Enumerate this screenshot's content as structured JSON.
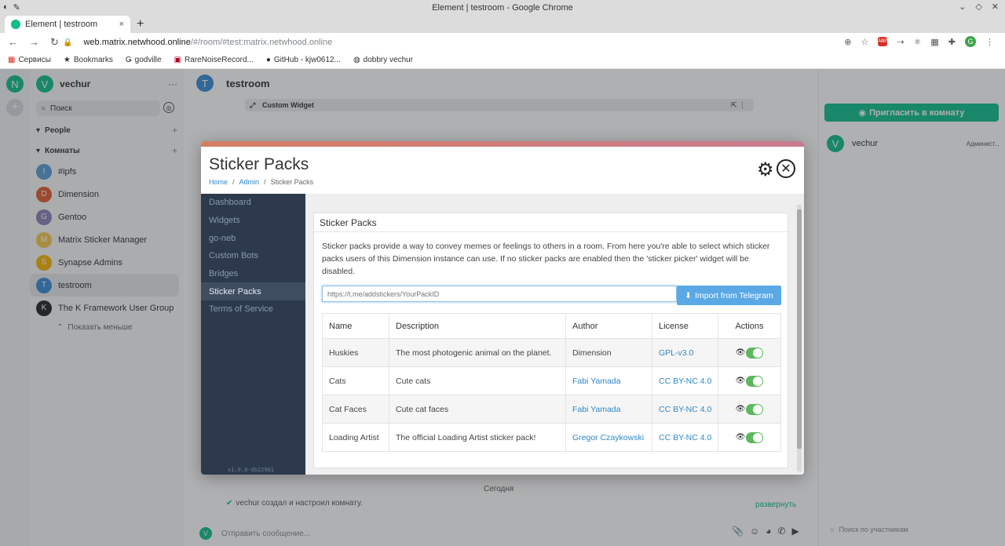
{
  "window": {
    "title": "Element | testroom - Google Chrome"
  },
  "tab": {
    "label": "Element | testroom",
    "close": "×",
    "new": "+"
  },
  "toolbar": {
    "url_host": "web.matrix.netwhood.online",
    "url_path": "/#/room/#test:matrix.netwhood.online",
    "profile_initial": "G",
    "abp": "ABP"
  },
  "bookmarks": [
    "Сервисы",
    "Bookmarks",
    "godville",
    "RareNoiseRecord...",
    "GitHub - kjw0612...",
    "dobbry vechur"
  ],
  "element": {
    "space_initial": "N",
    "user": {
      "name": "vechur",
      "initial": "V"
    },
    "search_placeholder": "Поиск",
    "sections": {
      "people": "People",
      "rooms": "Комнаты"
    },
    "rooms": [
      {
        "name": "#ipfs",
        "initial": "I",
        "color": "#5b9bd5"
      },
      {
        "name": "Dimension",
        "initial": "D",
        "color": "#e05a2b"
      },
      {
        "name": "Gentoo",
        "initial": "G",
        "color": "#8a7fb8"
      },
      {
        "name": "Matrix Sticker Manager",
        "initial": "M",
        "color": "#f2c94c"
      },
      {
        "name": "Synapse Admins",
        "initial": "S",
        "color": "#f5b400"
      },
      {
        "name": "testroom",
        "initial": "T",
        "color": "#368bd6"
      },
      {
        "name": "The K Framework User Group",
        "initial": "K",
        "color": "#222222"
      }
    ],
    "show_less": "Показать меньше",
    "room_title": "testroom",
    "room_initial": "T",
    "widget_label": "Custom Widget",
    "today": "Сегодня",
    "event_text": "vechur создал и настроил комнату.",
    "expand": "развернуть",
    "composer_placeholder": "Отправить сообщение...",
    "invite_button": "Пригласить в комнату",
    "member": {
      "name": "vechur",
      "role": "Админист..."
    },
    "member_search": "Поиск по участникам"
  },
  "modal": {
    "title": "Sticker Packs",
    "breadcrumbs": [
      "Home",
      "Admin",
      "Sticker Packs"
    ],
    "sidebar": [
      "Dashboard",
      "Widgets",
      "go-neb",
      "Custom Bots",
      "Bridges",
      "Sticker Packs",
      "Terms of Service"
    ],
    "active_sidebar": "Sticker Packs",
    "version": "v1.0.0-db22981",
    "card_title": "Sticker Packs",
    "description": "Sticker packs provide a way to convey memes or feelings to others in a room. From here you're able to select which sticker packs users of this Dimension instance can use. If no sticker packs are enabled then the 'sticker picker' widget will be disabled.",
    "import_placeholder": "https://t.me/addstickers/YourPackID",
    "import_button": "Import from Telegram",
    "table": {
      "headers": [
        "Name",
        "Description",
        "Author",
        "License",
        "Actions"
      ],
      "rows": [
        {
          "name": "Huskies",
          "description": "The most photogenic animal on the planet.",
          "author": "Dimension",
          "license": "GPL-v3.0",
          "enabled": true
        },
        {
          "name": "Cats",
          "description": "Cute cats",
          "author": "Fabi Yamada",
          "license": "CC BY-NC 4.0",
          "enabled": true
        },
        {
          "name": "Cat Faces",
          "description": "Cute cat faces",
          "author": "Fabi Yamada",
          "license": "CC BY-NC 4.0",
          "enabled": true
        },
        {
          "name": "Loading Artist",
          "description": "The official Loading Artist sticker pack!",
          "author": "Gregor Czaykowski",
          "license": "CC BY-NC 4.0",
          "enabled": true
        }
      ]
    }
  }
}
